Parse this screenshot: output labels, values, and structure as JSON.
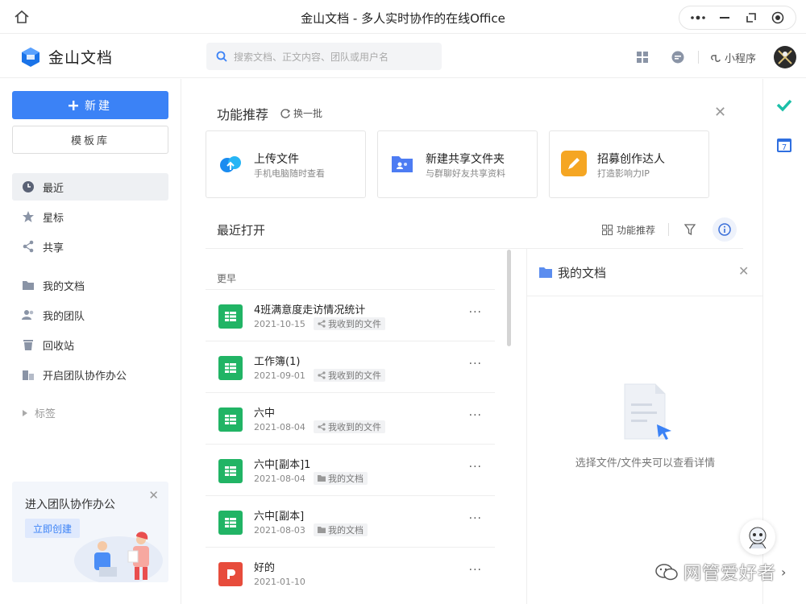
{
  "window": {
    "title": "金山文档 - 多人实时协作的在线Office"
  },
  "header": {
    "logo_text": "金山文档",
    "search_placeholder": "搜索文档、正文内容、团队或用户名",
    "mini_program": "小程序"
  },
  "sidebar": {
    "new_label": "新建",
    "template_label": "模板库",
    "items": [
      {
        "label": "最近",
        "icon": "clock-icon"
      },
      {
        "label": "星标",
        "icon": "star-icon"
      },
      {
        "label": "共享",
        "icon": "share-icon"
      },
      {
        "label": "我的文档",
        "icon": "folder-icon"
      },
      {
        "label": "我的团队",
        "icon": "team-icon"
      },
      {
        "label": "回收站",
        "icon": "trash-icon"
      },
      {
        "label": "开启团队协作办公",
        "icon": "building-icon"
      }
    ],
    "tags_label": "标签",
    "promo": {
      "title": "进入团队协作办公",
      "button": "立即创建"
    }
  },
  "features": {
    "title": "功能推荐",
    "refresh_label": "换一批",
    "cards": [
      {
        "title": "上传文件",
        "desc": "手机电脑随时查看",
        "icon": "cloud-upload-icon"
      },
      {
        "title": "新建共享文件夹",
        "desc": "与群聊好友共享资料",
        "icon": "shared-folder-icon"
      },
      {
        "title": "招募创作达人",
        "desc": "打造影响力IP",
        "icon": "pencil-icon"
      }
    ]
  },
  "recent": {
    "title": "最近打开",
    "feature_toggle": "功能推荐",
    "group_label": "更早",
    "files": [
      {
        "name": "4班满意度走访情况统计",
        "date": "2021-10-15",
        "tag": "我收到的文件",
        "type": "sheet"
      },
      {
        "name": "工作簿(1)",
        "date": "2021-09-01",
        "tag": "我收到的文件",
        "type": "sheet"
      },
      {
        "name": "六中",
        "date": "2021-08-04",
        "tag": "我收到的文件",
        "type": "sheet"
      },
      {
        "name": "六中[副本]1",
        "date": "2021-08-04",
        "tag": "我的文档",
        "type": "sheet"
      },
      {
        "name": "六中[副本]",
        "date": "2021-08-03",
        "tag": "我的文档",
        "type": "sheet"
      },
      {
        "name": "好的",
        "date": "2021-01-10",
        "tag": "",
        "type": "ppt"
      }
    ],
    "more_label": "···"
  },
  "detail": {
    "title": "我的文档",
    "empty_text": "选择文件/文件夹可以查看详情"
  },
  "watermark": "网管爱好者",
  "colors": {
    "accent": "#3b82f6",
    "sheet": "#21b465",
    "ppt": "#e74c3c"
  }
}
